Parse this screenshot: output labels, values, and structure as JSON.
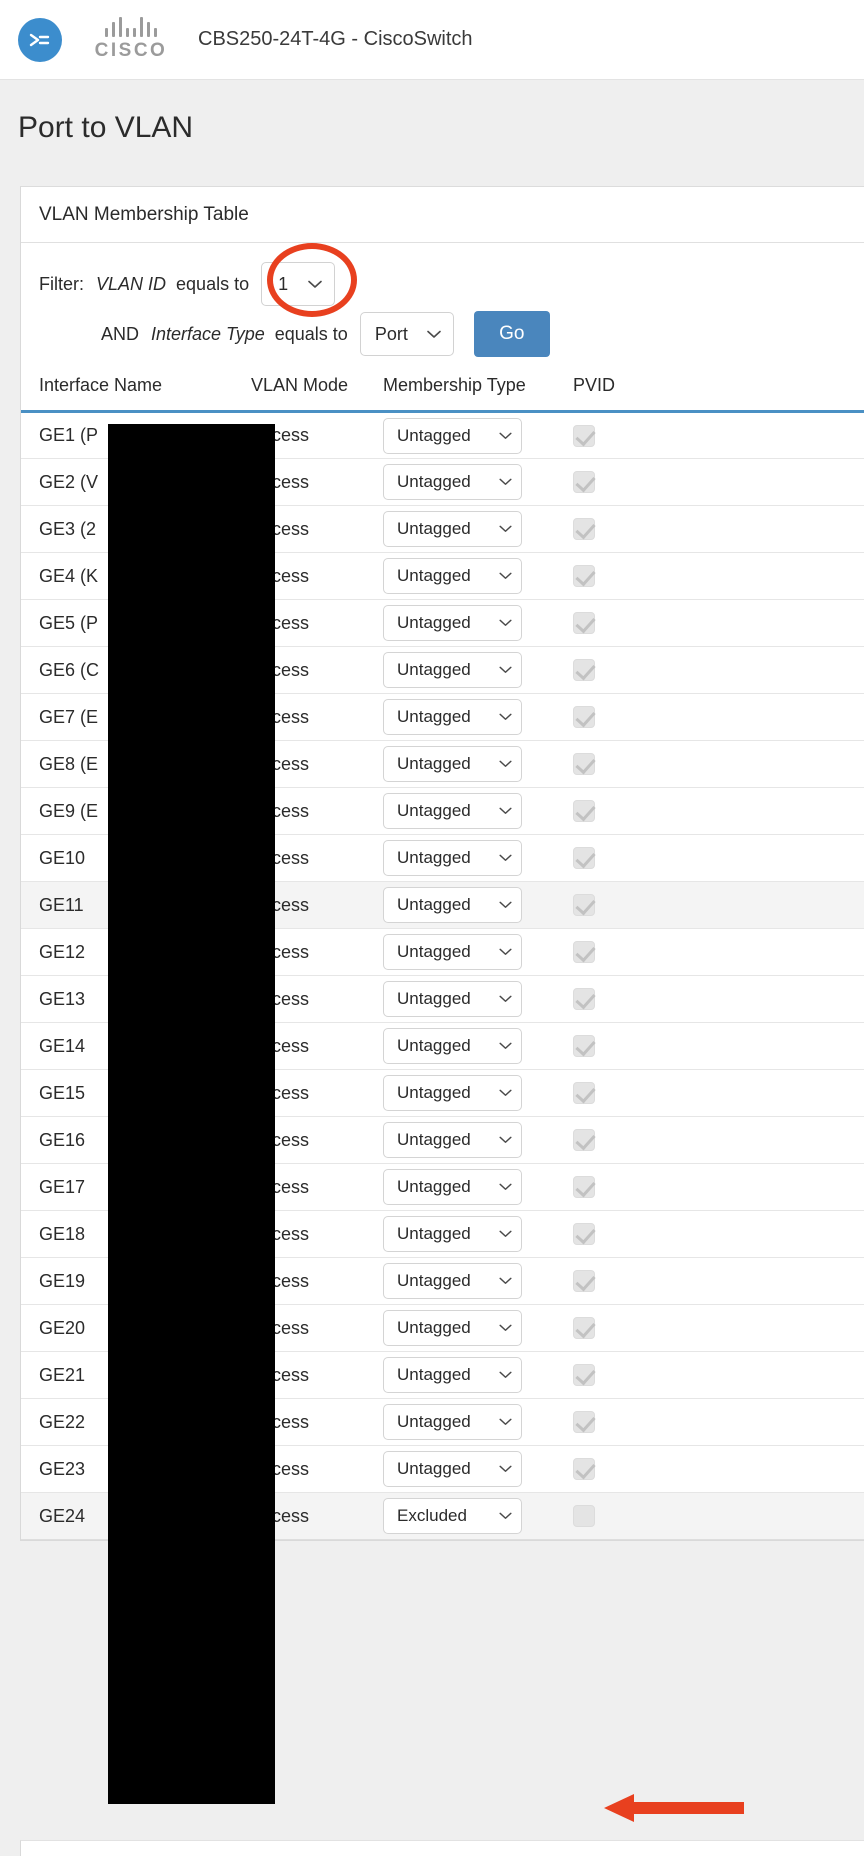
{
  "topbar": {
    "app_icon": "switch-arrows-icon",
    "brand_icon": "cisco-logo",
    "brand_word": "CISCO",
    "device_title": "CBS250-24T-4G - CiscoSwitch"
  },
  "page": {
    "title": "Port to VLAN"
  },
  "card": {
    "title": "VLAN Membership Table"
  },
  "filter": {
    "filter_label": "Filter:",
    "vlan_id_label": "VLAN ID",
    "equals_to_label_1": "equals to",
    "vlan_id_value": "1",
    "and_label": "AND",
    "interface_type_label": "Interface Type",
    "equals_to_label_2": "equals to",
    "interface_type_value": "Port",
    "go_label": "Go"
  },
  "table": {
    "columns": [
      "Interface Name",
      "VLAN Mode",
      "Membership Type",
      "PVID"
    ],
    "rows": [
      {
        "interface": "GE1 (P",
        "mode": "Access",
        "membership": "Untagged",
        "pvid": true,
        "shaded": false
      },
      {
        "interface": "GE2 (V",
        "mode": "Access",
        "membership": "Untagged",
        "pvid": true,
        "shaded": false
      },
      {
        "interface": "GE3 (2",
        "mode": "Access",
        "membership": "Untagged",
        "pvid": true,
        "shaded": false
      },
      {
        "interface": "GE4 (K",
        "mode": "Access",
        "membership": "Untagged",
        "pvid": true,
        "shaded": false
      },
      {
        "interface": "GE5 (P",
        "mode": "Access",
        "membership": "Untagged",
        "pvid": true,
        "shaded": false
      },
      {
        "interface": "GE6 (C",
        "mode": "Access",
        "membership": "Untagged",
        "pvid": true,
        "shaded": false
      },
      {
        "interface": "GE7 (E",
        "mode": "Access",
        "membership": "Untagged",
        "pvid": true,
        "shaded": false
      },
      {
        "interface": "GE8 (E",
        "mode": "Access",
        "membership": "Untagged",
        "pvid": true,
        "shaded": false
      },
      {
        "interface": "GE9 (E",
        "mode": "Access",
        "membership": "Untagged",
        "pvid": true,
        "shaded": false
      },
      {
        "interface": "GE10",
        "mode": "Access",
        "membership": "Untagged",
        "pvid": true,
        "shaded": false
      },
      {
        "interface": "GE11",
        "mode": "Access",
        "membership": "Untagged",
        "pvid": true,
        "shaded": true
      },
      {
        "interface": "GE12",
        "mode": "Access",
        "membership": "Untagged",
        "pvid": true,
        "shaded": false
      },
      {
        "interface": "GE13",
        "mode": "Access",
        "membership": "Untagged",
        "pvid": true,
        "shaded": false
      },
      {
        "interface": "GE14",
        "mode": "Access",
        "membership": "Untagged",
        "pvid": true,
        "shaded": false
      },
      {
        "interface": "GE15",
        "mode": "Access",
        "membership": "Untagged",
        "pvid": true,
        "shaded": false
      },
      {
        "interface": "GE16",
        "mode": "Access",
        "membership": "Untagged",
        "pvid": true,
        "shaded": false
      },
      {
        "interface": "GE17",
        "mode": "Access",
        "membership": "Untagged",
        "pvid": true,
        "shaded": false
      },
      {
        "interface": "GE18",
        "mode": "Access",
        "membership": "Untagged",
        "pvid": true,
        "shaded": false
      },
      {
        "interface": "GE19",
        "mode": "Access",
        "membership": "Untagged",
        "pvid": true,
        "shaded": false
      },
      {
        "interface": "GE20",
        "mode": "Access",
        "membership": "Untagged",
        "pvid": true,
        "shaded": false
      },
      {
        "interface": "GE21",
        "mode": "Access",
        "membership": "Untagged",
        "pvid": true,
        "shaded": false
      },
      {
        "interface": "GE22",
        "mode": "Access",
        "membership": "Untagged",
        "pvid": true,
        "shaded": false
      },
      {
        "interface": "GE23",
        "mode": "Access",
        "membership": "Untagged",
        "pvid": true,
        "shaded": false
      },
      {
        "interface": "GE24",
        "mode": "Access",
        "membership": "Excluded",
        "pvid": false,
        "shaded": true
      }
    ]
  },
  "annotations": {
    "ellipse_target": "vlan-id-select",
    "ellipse_color": "#e8401f",
    "arrow_target": "pvid-checkbox-ge24",
    "arrow_color": "#e8401f",
    "redaction_color": "#000000"
  },
  "colors": {
    "accent_blue": "#4a86bd",
    "header_underline": "#4a90c4",
    "page_background": "#efefef",
    "row_shaded": "#f4f4f4"
  }
}
